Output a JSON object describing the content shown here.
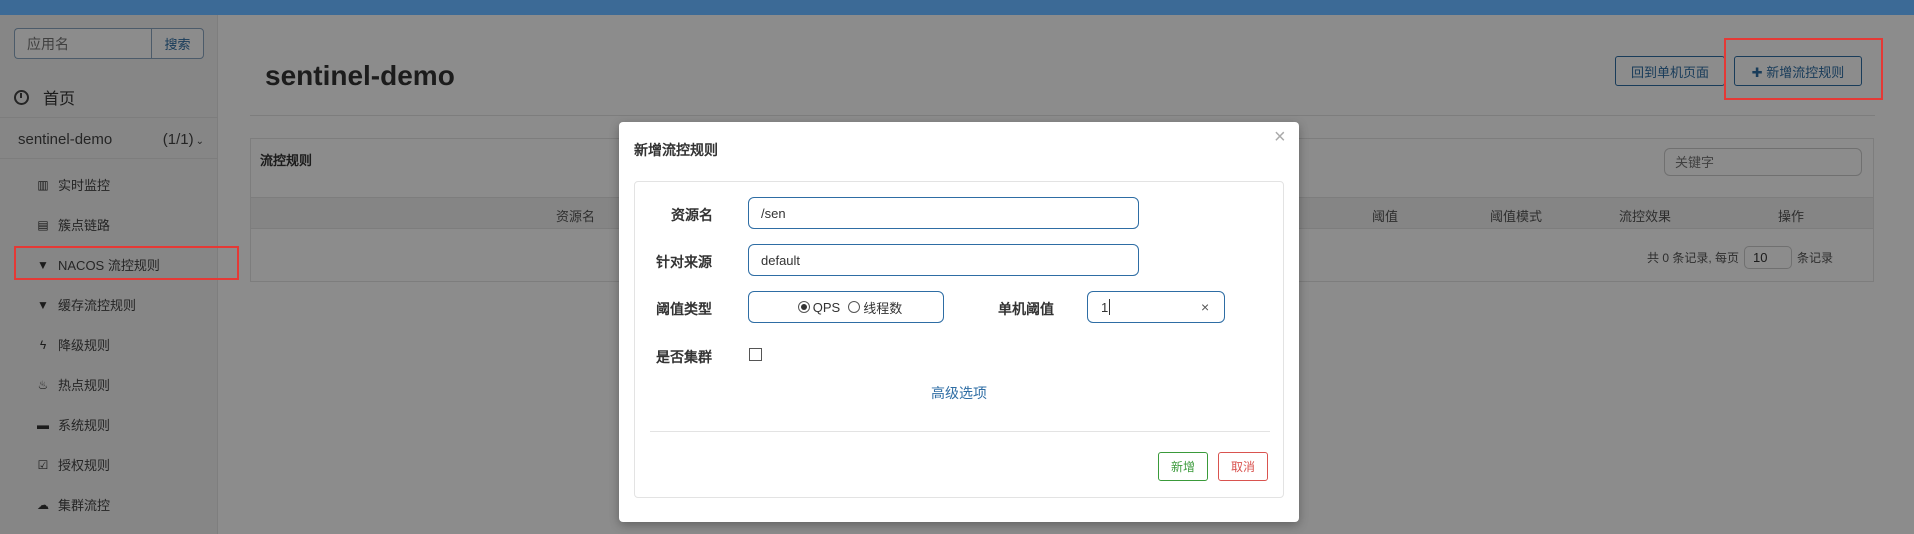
{
  "sidebar": {
    "search_placeholder": "应用名",
    "search_button": "搜索",
    "home_label": "首页",
    "app_name": "sentinel-demo",
    "app_count": "(1/1)",
    "items": [
      {
        "label": "实时监控",
        "icon": "bar-chart-icon",
        "glyph": "▥"
      },
      {
        "label": "簇点链路",
        "icon": "list-icon",
        "glyph": "▤"
      },
      {
        "label": "NACOS 流控规则",
        "icon": "filter-icon",
        "glyph": "▼"
      },
      {
        "label": "缓存流控规则",
        "icon": "filter-icon",
        "glyph": "▼"
      },
      {
        "label": "降级规则",
        "icon": "bolt-icon",
        "glyph": "ϟ"
      },
      {
        "label": "热点规则",
        "icon": "fire-icon",
        "glyph": "♨"
      },
      {
        "label": "系统规则",
        "icon": "lock-icon",
        "glyph": "▬"
      },
      {
        "label": "授权规则",
        "icon": "check-square-icon",
        "glyph": "☑"
      },
      {
        "label": "集群流控",
        "icon": "cloud-icon",
        "glyph": "☁"
      }
    ]
  },
  "main": {
    "title": "sentinel-demo",
    "back_button": "回到单机页面",
    "add_button": "✚ 新增流控规则",
    "panel_title": "流控规则",
    "keyword_placeholder": "关键字",
    "columns": [
      "资源名",
      "阈值",
      "阈值模式",
      "流控效果",
      "操作"
    ],
    "pager_prefix": "共 0 条记录, 每页",
    "page_size": "10",
    "pager_suffix": "条记录"
  },
  "modal": {
    "title": "新增流控规则",
    "close": "×",
    "labels": {
      "resource": "资源名",
      "origin": "针对来源",
      "threshold_type": "阈值类型",
      "single_threshold": "单机阈值",
      "cluster": "是否集群"
    },
    "resource_value": "/sen",
    "origin_value": "default",
    "radio_qps": "QPS",
    "radio_threads": "线程数",
    "threshold_value": "1",
    "clear": "×",
    "advanced": "高级选项",
    "ok_button": "新增",
    "cancel_button": "取消"
  },
  "colors": {
    "topbar": "#3c6a96",
    "primary": "#2e6da4",
    "highlight": "#e53935",
    "success": "#3a9a3a",
    "danger": "#d9534f"
  }
}
